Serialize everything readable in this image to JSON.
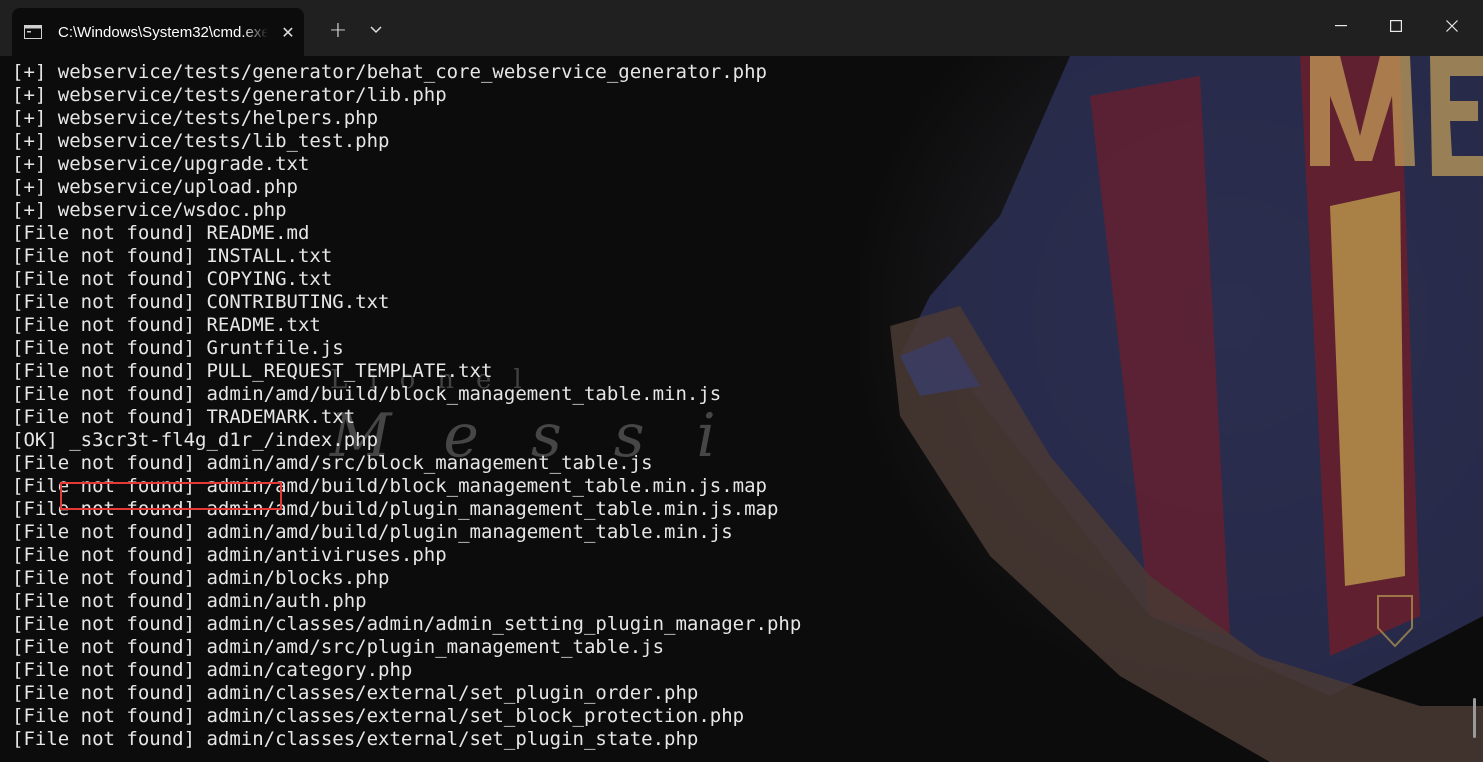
{
  "window": {
    "tab_title": "C:\\Windows\\System32\\cmd.exe",
    "tab_icon": "terminal-icon",
    "close_tab_icon": "close-icon",
    "new_tab_icon": "plus-icon",
    "dropdown_icon": "chevron-down-icon",
    "minimize_icon": "minimize-icon",
    "maximize_icon": "maximize-icon",
    "close_window_icon": "close-icon"
  },
  "background": {
    "watermark_word1": "Lionel",
    "watermark_word2": "Messi",
    "jersey_text": "ME"
  },
  "theme": {
    "terminal_bg": "#0c0c0c",
    "text_color": "#e6e6e6",
    "highlight_border": "#e53935",
    "titlebar_bg": "#202020"
  },
  "terminal": {
    "lines": [
      "[+] webservice/tests/generator/behat_core_webservice_generator.php",
      "[+] webservice/tests/generator/lib.php",
      "[+] webservice/tests/helpers.php",
      "[+] webservice/tests/lib_test.php",
      "[+] webservice/upgrade.txt",
      "[+] webservice/upload.php",
      "[+] webservice/wsdoc.php",
      "[File not found] README.md",
      "[File not found] INSTALL.txt",
      "[File not found] COPYING.txt",
      "[File not found] CONTRIBUTING.txt",
      "[File not found] README.txt",
      "[File not found] Gruntfile.js",
      "[File not found] PULL_REQUEST_TEMPLATE.txt",
      "[File not found] admin/amd/build/block_management_table.min.js",
      "[File not found] TRADEMARK.txt",
      "[OK] _s3cr3t-fl4g_d1r_/index.php",
      "[File not found] admin/amd/src/block_management_table.js",
      "[File not found] admin/amd/build/block_management_table.min.js.map",
      "[File not found] admin/amd/build/plugin_management_table.min.js.map",
      "[File not found] admin/amd/build/plugin_management_table.min.js",
      "[File not found] admin/antiviruses.php",
      "[File not found] admin/blocks.php",
      "[File not found] admin/auth.php",
      "[File not found] admin/classes/admin/admin_setting_plugin_manager.php",
      "[File not found] admin/amd/src/plugin_management_table.js",
      "[File not found] admin/category.php",
      "[File not found] admin/classes/external/set_plugin_order.php",
      "[File not found] admin/classes/external/set_block_protection.php",
      "[File not found] admin/classes/external/set_plugin_state.php"
    ]
  }
}
